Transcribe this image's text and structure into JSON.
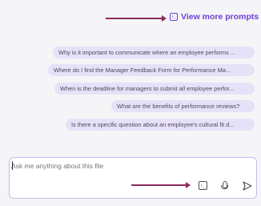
{
  "header": {
    "view_more_label": "View more prompts"
  },
  "suggestions": [
    "Why is it important to communicate where an employee performs ...",
    "Where do I find the Manager Feedback Form for Performance Ma...",
    "When is the deadline for managers to submit all employee perfor...",
    "What are the benefits of performance reviews?",
    "Is there a specific question about an employee's cultural fit d..."
  ],
  "chat": {
    "placeholder": "Ask me anything about this file"
  },
  "icons": {
    "prompt": "prompt-icon",
    "mic": "microphone-icon",
    "send": "send-icon",
    "arrow": "arrow-right-icon"
  },
  "colors": {
    "accent": "#6f3fd6",
    "chip_bg": "#e7e1f8",
    "arrow": "#8a2a5c",
    "border": "#cbb7ef"
  }
}
